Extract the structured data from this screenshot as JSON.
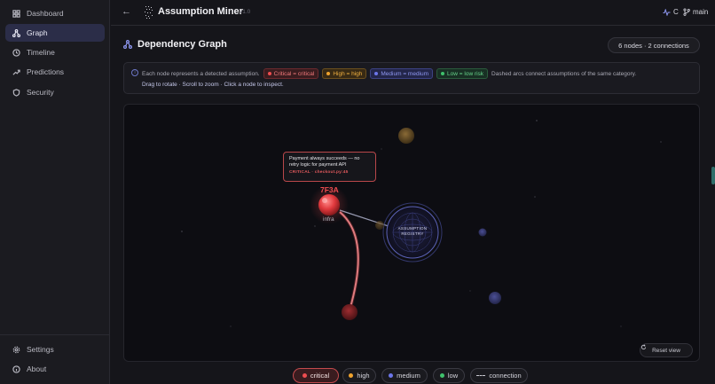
{
  "sidebar": {
    "items": [
      {
        "label": "Dashboard",
        "icon": "grid-icon"
      },
      {
        "label": "Graph",
        "icon": "graph-icon",
        "active": true
      },
      {
        "label": "Timeline",
        "icon": "clock-icon"
      },
      {
        "label": "Predictions",
        "icon": "trend-icon"
      },
      {
        "label": "Security",
        "icon": "shield-icon"
      }
    ],
    "bottom": [
      {
        "label": "Settings",
        "icon": "gear-icon"
      },
      {
        "label": "About",
        "icon": "info-icon"
      }
    ]
  },
  "header": {
    "back_icon": "←",
    "title": "Assumption Miner",
    "version": "v1.0",
    "activity_label": "C",
    "branch_label": "main"
  },
  "page": {
    "title": "Dependency Graph",
    "stats": "6 nodes · 2 connections"
  },
  "info": {
    "intro": "Each node represents a detected assumption.",
    "chips": {
      "critical": "Critical = critical",
      "high": "High = high",
      "medium": "Medium = medium",
      "low": "Low = low risk"
    },
    "tail": "Dashed arcs connect assumptions of the same category.",
    "hint": "Drag to rotate · Scroll to zoom · Click a node to inspect."
  },
  "graph": {
    "tooltip_text": "Payment always succeeds — no retry logic for payment API",
    "tooltip_meta": "CRITICAL · checkout.py:45",
    "selected_node_id": "7F3A",
    "selected_node_category": "infra",
    "core_label_1": "ASSUMPTION",
    "core_label_2": "REGISTRY",
    "reset_label": "Reset view"
  },
  "legend": {
    "critical": "critical",
    "high": "high",
    "medium": "medium",
    "low": "low",
    "connection": "connection"
  },
  "colors": {
    "critical": "#ef4d50",
    "high": "#f0a32e",
    "medium": "#6c76ea",
    "low": "#3fc26c",
    "accent": "#6d77c7"
  }
}
